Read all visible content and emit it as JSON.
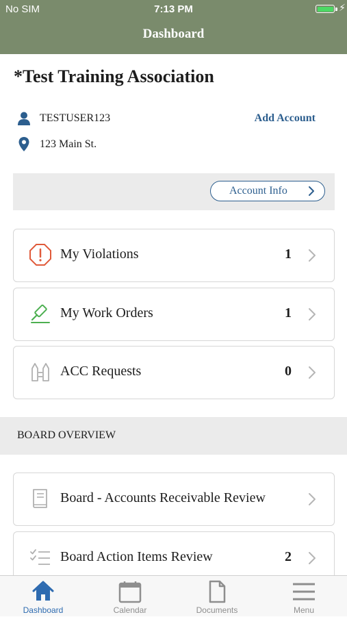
{
  "status_bar": {
    "carrier": "No SIM",
    "time": "7:13 PM",
    "battery_level": 1.0
  },
  "header": {
    "title": "Dashboard"
  },
  "association": {
    "name": "*Test Training Association"
  },
  "user": {
    "username": "TESTUSER123",
    "address": "123 Main St.",
    "add_account_label": "Add Account"
  },
  "account_info": {
    "label": "Account Info"
  },
  "cards": [
    {
      "label": "My Violations",
      "count": "1",
      "icon": "alert-octagon-icon"
    },
    {
      "label": "My Work Orders",
      "count": "1",
      "icon": "gavel-icon"
    },
    {
      "label": "ACC Requests",
      "count": "0",
      "icon": "acc-request-icon"
    }
  ],
  "board": {
    "section_title": "BOARD OVERVIEW",
    "items": [
      {
        "label": "Board - Accounts Receivable Review",
        "count": "",
        "icon": "book-icon"
      },
      {
        "label": "Board Action Items Review",
        "count": "2",
        "icon": "checklist-icon"
      }
    ]
  },
  "tabbar": {
    "tabs": [
      {
        "label": "Dashboard",
        "icon": "home-icon",
        "active": true
      },
      {
        "label": "Calendar",
        "icon": "calendar-icon",
        "active": false
      },
      {
        "label": "Documents",
        "icon": "document-icon",
        "active": false
      },
      {
        "label": "Menu",
        "icon": "menu-icon",
        "active": false
      }
    ]
  },
  "colors": {
    "header": "#7a8b6c",
    "accent": "#2c5e8e",
    "alert": "#e05a3a",
    "work_order": "#4caf50",
    "tab_active": "#2e6bb0"
  }
}
